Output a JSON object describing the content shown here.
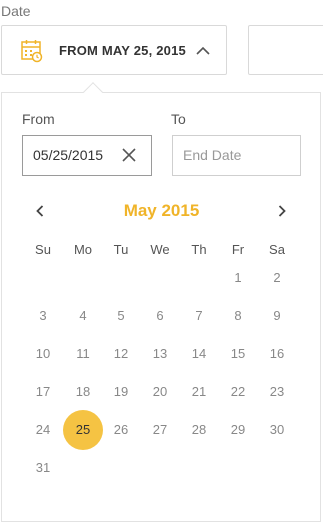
{
  "header": {
    "label": "Date",
    "trigger_text": "FROM MAY 25, 2015"
  },
  "range": {
    "from_label": "From",
    "to_label": "To",
    "from_value": "05/25/2015",
    "to_placeholder": "End Date"
  },
  "calendar": {
    "month_title": "May 2015",
    "weekdays": [
      "Su",
      "Mo",
      "Tu",
      "We",
      "Th",
      "Fr",
      "Sa"
    ],
    "weeks": [
      [
        "",
        "",
        "",
        "",
        "",
        "1",
        "2"
      ],
      [
        "3",
        "4",
        "5",
        "6",
        "7",
        "8",
        "9"
      ],
      [
        "10",
        "11",
        "12",
        "13",
        "14",
        "15",
        "16"
      ],
      [
        "17",
        "18",
        "19",
        "20",
        "21",
        "22",
        "23"
      ],
      [
        "24",
        "25",
        "26",
        "27",
        "28",
        "29",
        "30"
      ],
      [
        "31",
        "",
        "",
        "",
        "",
        "",
        ""
      ]
    ],
    "selected_day": "25"
  },
  "colors": {
    "accent": "#f0b429",
    "selected_fill": "#f5c343"
  },
  "icons": {
    "trigger": "calendar-icon",
    "toggle": "chevron-up-icon",
    "clear": "close-icon",
    "prev": "chevron-left-icon",
    "next": "chevron-right-icon"
  }
}
